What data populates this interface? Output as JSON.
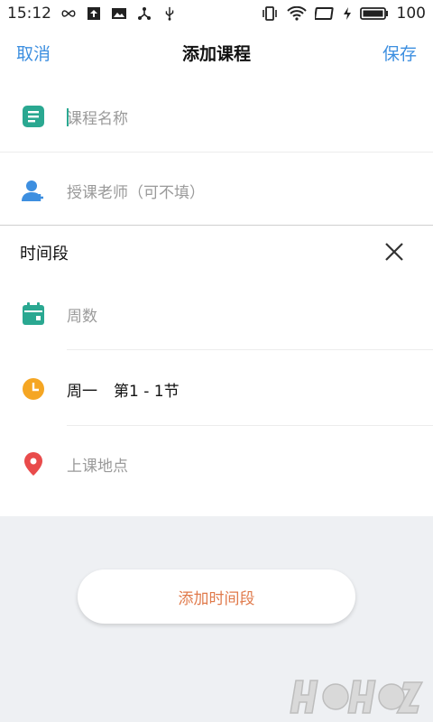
{
  "status_bar": {
    "time": "15:12",
    "battery": "100",
    "icons": [
      "infinity-icon",
      "upload-icon",
      "image-icon",
      "share-icon",
      "usb-icon",
      "vibrate-icon",
      "wifi-icon",
      "tablet-icon",
      "charging-icon",
      "battery-icon"
    ]
  },
  "navbar": {
    "cancel_label": "取消",
    "title": "添加课程",
    "save_label": "保存"
  },
  "course": {
    "name_placeholder": "课程名称",
    "teacher_placeholder": "授课老师（可不填）"
  },
  "time_section": {
    "title": "时间段",
    "weeks_placeholder": "周数",
    "day_value": "周一",
    "period_value": "第1 - 1节",
    "location_placeholder": "上课地点"
  },
  "add_button_label": "添加时间段",
  "colors": {
    "accent_blue": "#3d8fe0",
    "teal": "#2aa891",
    "clock_orange": "#f5a623",
    "pin_red": "#e94b4b",
    "add_text": "#e07a4b"
  }
}
